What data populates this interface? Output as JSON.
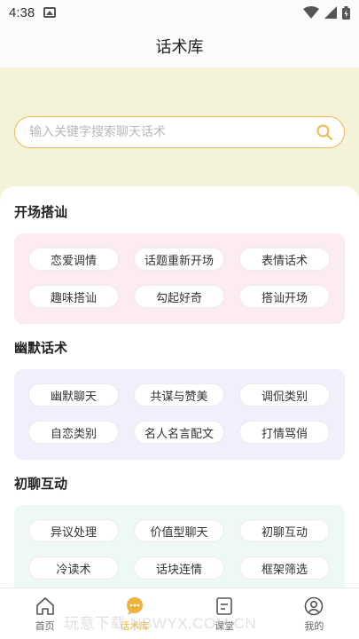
{
  "status_bar": {
    "time": "4:38"
  },
  "header": {
    "title": "话术库"
  },
  "search": {
    "placeholder": "输入关键字搜索聊天话术"
  },
  "sections": [
    {
      "title": "开场搭讪",
      "items": [
        "恋爱调情",
        "话题重新开场",
        "表情话术",
        "趣味搭讪",
        "勾起好奇",
        "搭讪开场"
      ]
    },
    {
      "title": "幽默话术",
      "items": [
        "幽默聊天",
        "共谋与赞美",
        "调侃类别",
        "自恋类别",
        "名人名言配文",
        "打情骂俏"
      ]
    },
    {
      "title": "初聊互动",
      "items": [
        "异议处理",
        "价值型聊天",
        "初聊互动",
        "冷读术",
        "话块连情",
        "框架筛选"
      ]
    }
  ],
  "tab_bar": {
    "items": [
      {
        "label": "首页",
        "icon": "home-icon"
      },
      {
        "label": "话术库",
        "icon": "chat-bubble-icon"
      },
      {
        "label": "课堂",
        "icon": "book-icon"
      },
      {
        "label": "我的",
        "icon": "user-icon"
      }
    ],
    "active_color": "#f0b33a"
  },
  "watermark": "玩意下载 NBWYX.COM.CN",
  "colors": {
    "accent": "#f2b950",
    "header_bg": "#f4f2d8"
  }
}
